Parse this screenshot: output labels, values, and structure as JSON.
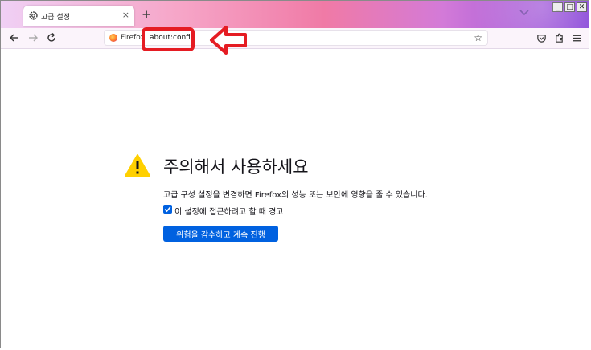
{
  "tab": {
    "title": "고급 설정",
    "close": "×"
  },
  "newtab": "+",
  "window": {
    "min": "_",
    "max": "□",
    "close": "✕"
  },
  "urlbar": {
    "identity": "Firefox",
    "url": "about:config"
  },
  "warning": {
    "heading": "주의해서 사용하세요",
    "description": "고급 구성 설정을 변경하면 Firefox의 성능 또는 보안에 영향을 줄 수 있습니다.",
    "checkbox_label": "이 설정에 접근하려고 할 때 경고",
    "checkbox_checked": true,
    "accept_button": "위험을 감수하고 계속 진행"
  },
  "colors": {
    "accent": "#0061e0",
    "highlight": "#e51c23",
    "warning": "#ffd000"
  },
  "icons": [
    "gear-icon",
    "close-icon",
    "plus-icon",
    "chevron-down-icon",
    "back-icon",
    "forward-icon",
    "reload-icon",
    "firefox-icon",
    "star-icon",
    "pocket-icon",
    "extensions-icon",
    "menu-icon",
    "warning-icon",
    "checkmark-icon",
    "arrow-icon"
  ]
}
